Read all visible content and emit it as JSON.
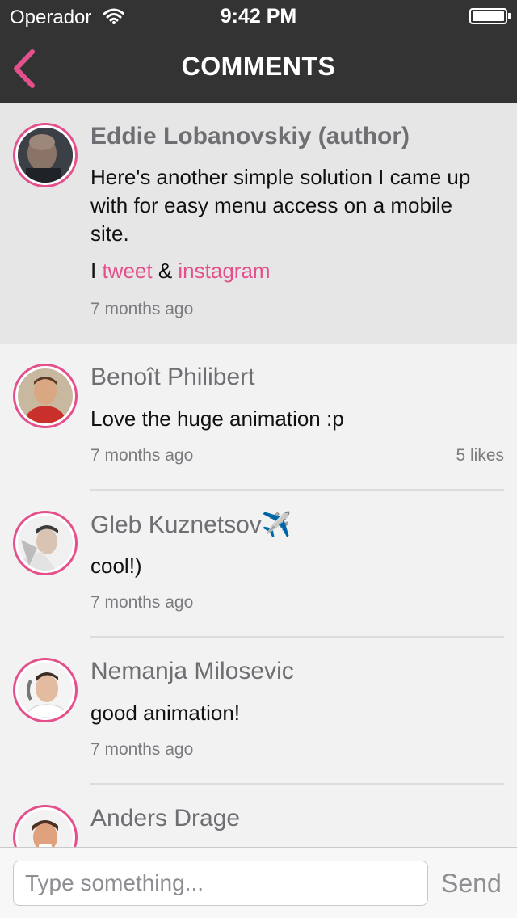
{
  "status_bar": {
    "carrier": "Operador",
    "time": "9:42 PM"
  },
  "nav": {
    "title": "COMMENTS"
  },
  "author_comment": {
    "name": "Eddie Lobanovskiy (author)",
    "text": "Here's another simple solution I came up with for easy menu access on a mobile site.",
    "links_line": {
      "prefix": "I ",
      "link1": "tweet",
      "joiner": " & ",
      "link2": "instagram"
    },
    "time": "7 months ago"
  },
  "comments": [
    {
      "name": "Benoît Philibert",
      "text": "Love the huge animation :p",
      "time": "7 months ago",
      "likes": "5 likes"
    },
    {
      "name": "Gleb Kuznetsov✈️",
      "text": "cool!)",
      "time": "7 months ago"
    },
    {
      "name": "Nemanja Milosevic",
      "text": "good animation!",
      "time": "7 months ago"
    },
    {
      "name": "Anders Drage"
    }
  ],
  "input": {
    "placeholder": "Type something...",
    "send_label": "Send"
  },
  "colors": {
    "accent": "#e4508c",
    "header_bg": "#333333",
    "author_bg": "#e6e6e6",
    "list_bg": "#f2f2f2"
  }
}
